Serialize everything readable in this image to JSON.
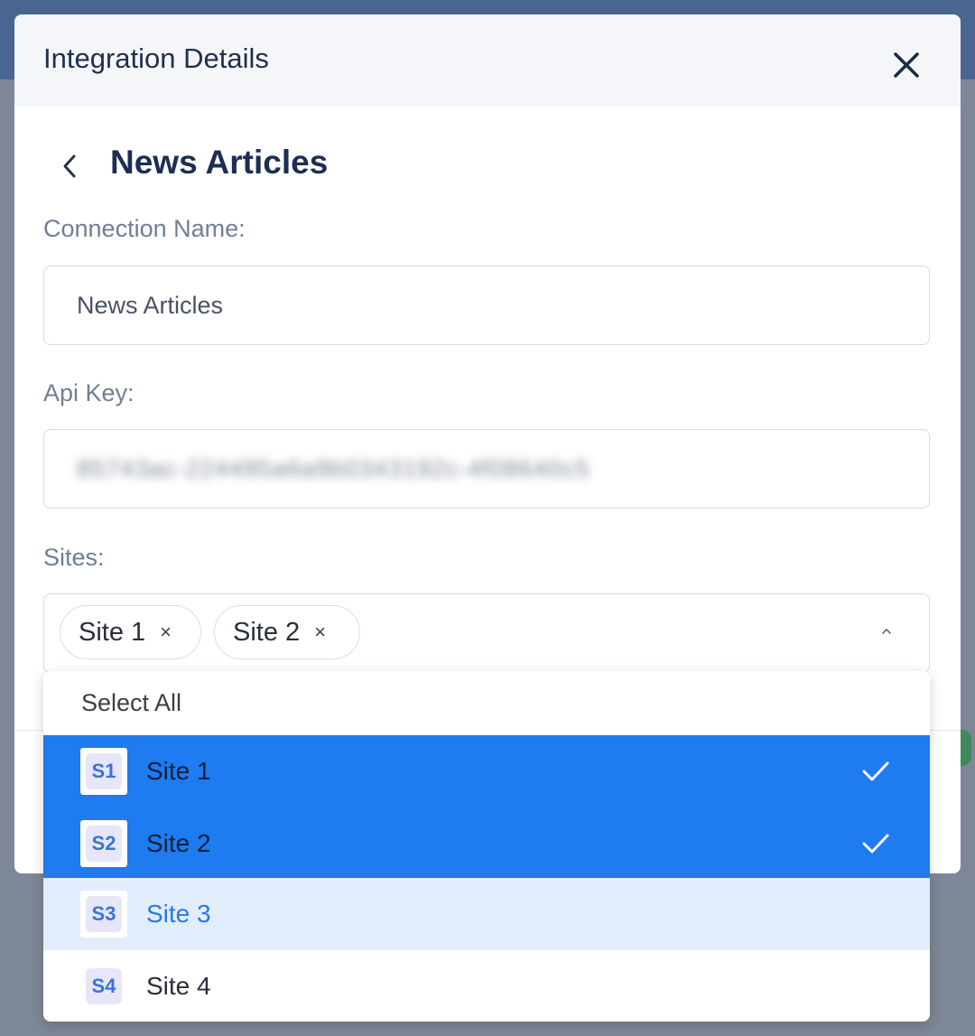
{
  "modal": {
    "title": "Integration Details",
    "close_icon": "close-icon"
  },
  "integration": {
    "back_icon": "chevron-left-icon",
    "title": "News Articles"
  },
  "connection_name": {
    "label": "Connection Name:",
    "value": "News Articles"
  },
  "api_key": {
    "label": "Api Key:",
    "value": "85743ac-224495a6a9b0343192c-4f08640c5"
  },
  "sites": {
    "label": "Sites:",
    "selected_chips": [
      {
        "label": "Site 1",
        "remove_icon": "×"
      },
      {
        "label": "Site 2",
        "remove_icon": "×"
      }
    ],
    "toggle_icon": "chevron-up-icon",
    "dropdown": {
      "select_all_label": "Select All",
      "options": [
        {
          "badge": "S1",
          "label": "Site 1",
          "selected": true,
          "hovered": false
        },
        {
          "badge": "S2",
          "label": "Site 2",
          "selected": true,
          "hovered": false
        },
        {
          "badge": "S3",
          "label": "Site 3",
          "selected": false,
          "hovered": true
        },
        {
          "badge": "S4",
          "label": "Site 4",
          "selected": false,
          "hovered": false
        }
      ],
      "check_icon": "check-icon"
    }
  },
  "colors": {
    "accent": "#1e7bf0",
    "hover_bg": "#e2edfb",
    "title_text": "#1c2e52",
    "label_text": "#6f7f96"
  }
}
